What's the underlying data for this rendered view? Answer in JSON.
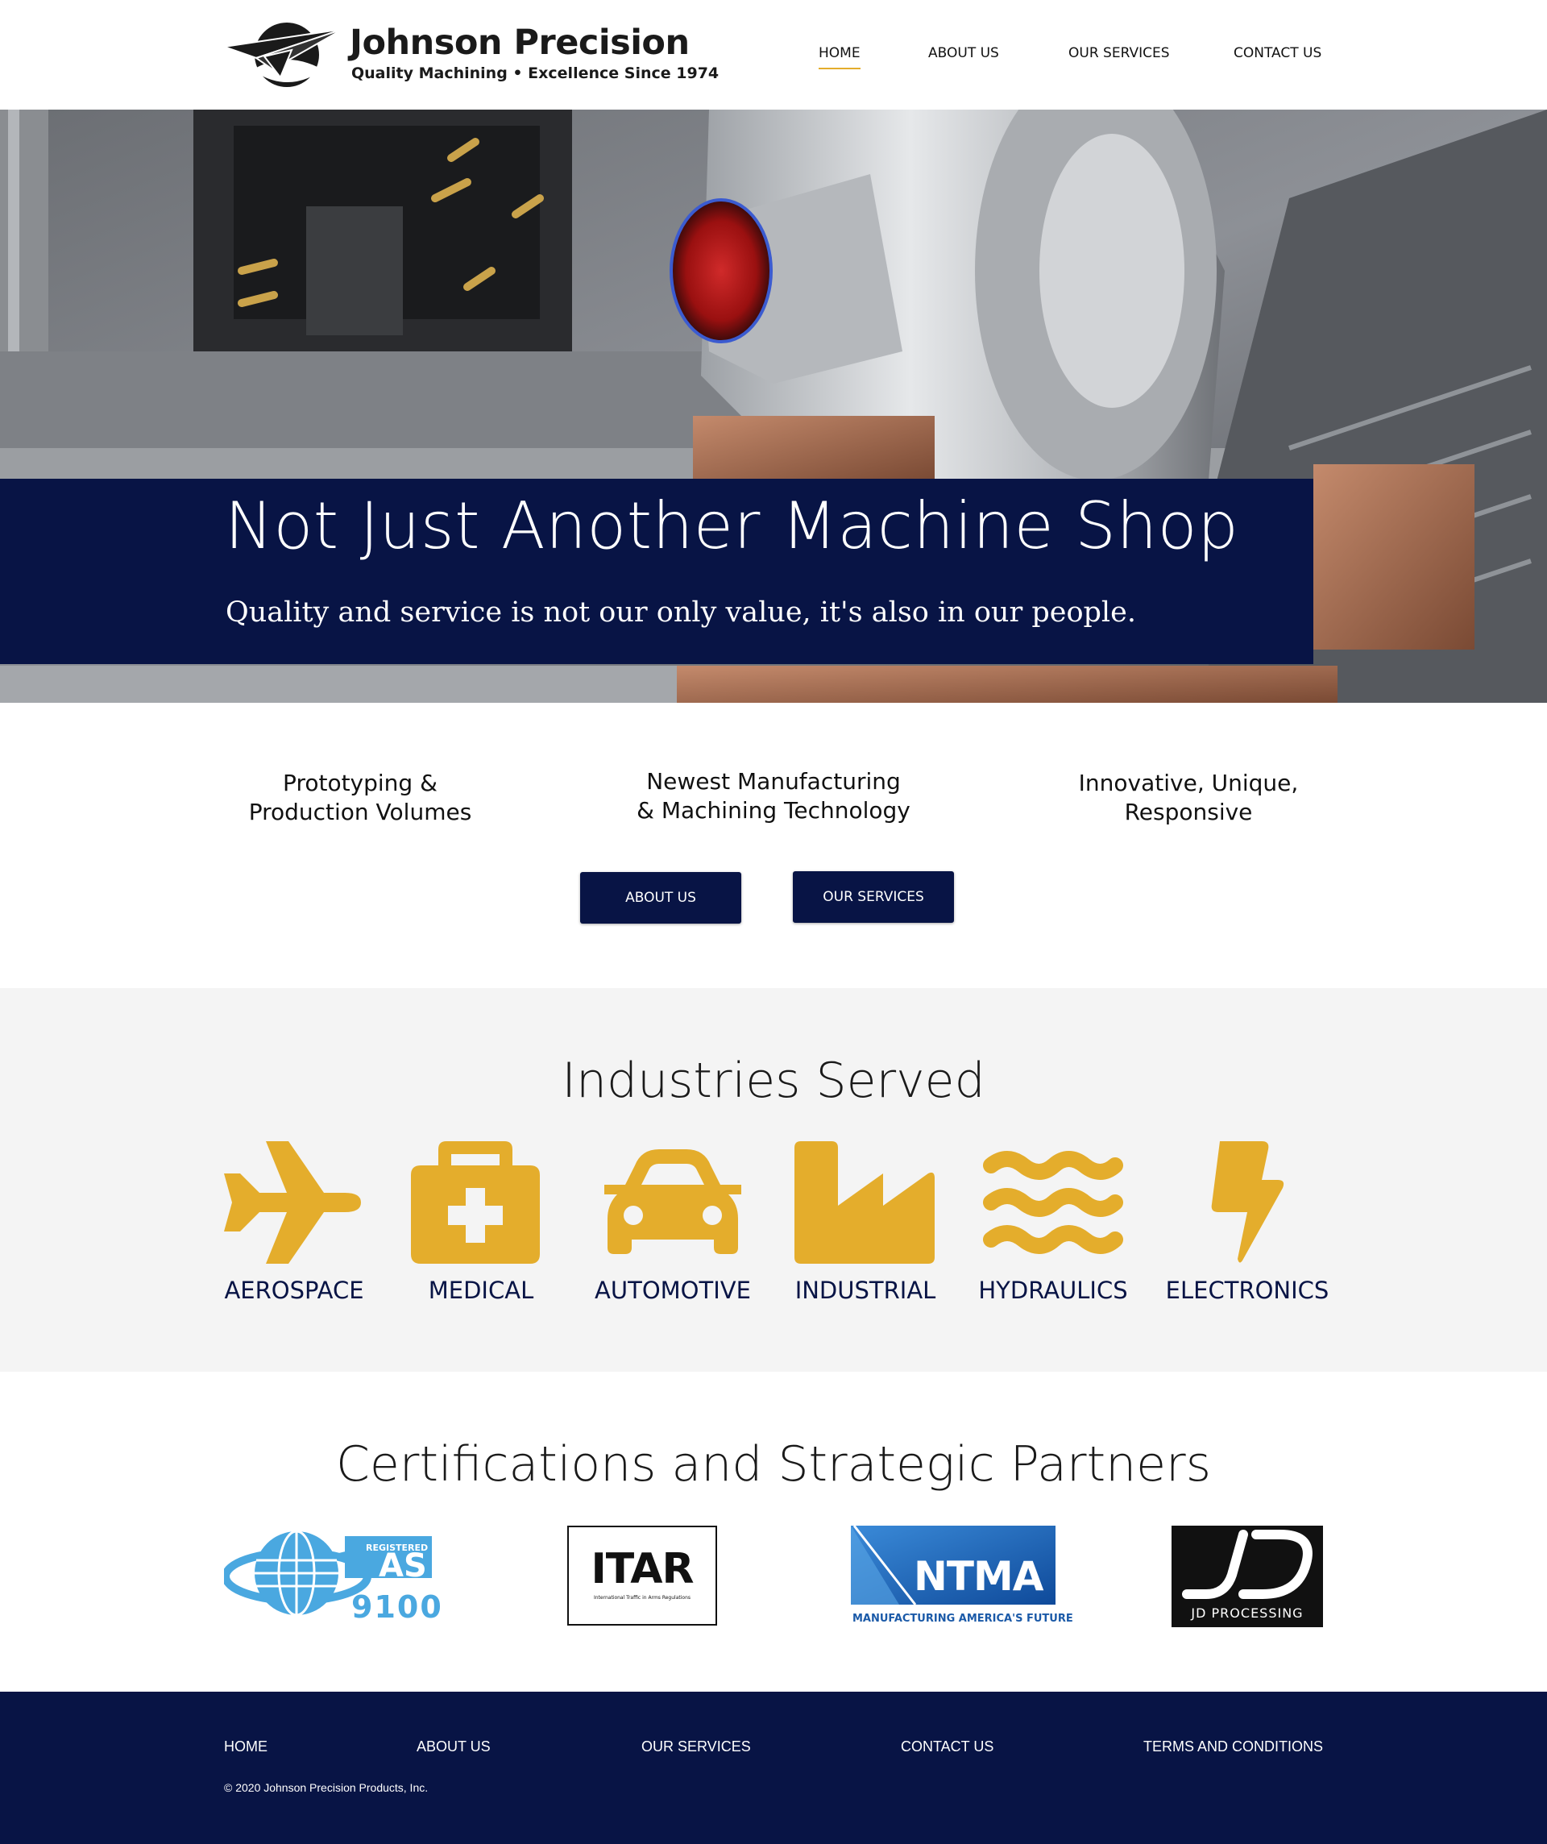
{
  "brand": {
    "name": "Johnson Precision",
    "tagline": "Quality Machining • Excellence Since 1974"
  },
  "nav": {
    "items": [
      "HOME",
      "ABOUT US",
      "OUR SERVICES",
      "CONTACT US"
    ],
    "active": "HOME"
  },
  "hero": {
    "title": "Not Just Another Machine Shop",
    "subtitle": "Quality and service is not our only value, it's also in our people."
  },
  "features": [
    {
      "line1": "Prototyping &",
      "line2": "Production Volumes"
    },
    {
      "line1": "Newest Manufacturing",
      "line2": "& Machining Technology"
    },
    {
      "line1": "Innovative, Unique,",
      "line2": "Responsive"
    }
  ],
  "buttons": {
    "about": "ABOUT US",
    "services": "OUR SERVICES"
  },
  "industries": {
    "title": "Industries Served",
    "items": [
      {
        "label": "AEROSPACE",
        "icon": "airplane-icon"
      },
      {
        "label": "MEDICAL",
        "icon": "medical-kit-icon"
      },
      {
        "label": "AUTOMOTIVE",
        "icon": "car-icon"
      },
      {
        "label": "INDUSTRIAL",
        "icon": "factory-icon"
      },
      {
        "label": "HYDRAULICS",
        "icon": "waves-icon"
      },
      {
        "label": "ELECTRONICS",
        "icon": "lightning-icon"
      }
    ],
    "icon_color": "#e4ad2c"
  },
  "certifications": {
    "title": "Certifications and Strategic Partners",
    "as9100": {
      "registered": "REGISTERED",
      "as": "AS",
      "number": "9100"
    },
    "itar": {
      "name": "ITAR",
      "caption": "International Traffic in Arms Regulations"
    },
    "ntma": {
      "name": "NTMA",
      "caption": "MANUFACTURING AMERICA'S FUTURE"
    },
    "jd": {
      "caption": "JD PROCESSING"
    }
  },
  "footer": {
    "links": [
      "HOME",
      "ABOUT US",
      "OUR SERVICES",
      "CONTACT US",
      "TERMS AND CONDITIONS"
    ],
    "copyright": "© 2020 Johnson Precision Products, Inc."
  },
  "colors": {
    "navy": "#081445",
    "gold": "#e4ad2c",
    "light_gray": "#f4f4f4"
  }
}
